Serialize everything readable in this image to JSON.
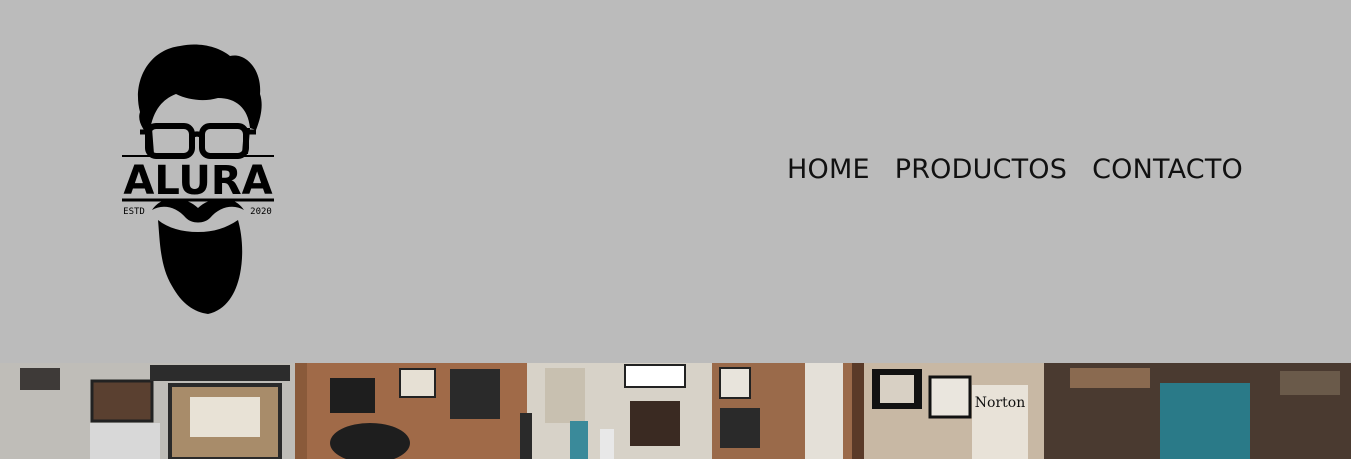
{
  "logo": {
    "name": "ALURA",
    "left_text": "ESTD",
    "right_text": "2020",
    "icon": "bearded-man-logo-icon"
  },
  "nav": {
    "items": [
      {
        "label": "HOME"
      },
      {
        "label": "PRODUCTOS"
      },
      {
        "label": "CONTACTO"
      }
    ]
  },
  "banner": {
    "description_icon": "barbershop-photo",
    "sign_text": "Norton"
  },
  "colors": {
    "header_bg": "#bbbbbb",
    "text": "#111111"
  }
}
